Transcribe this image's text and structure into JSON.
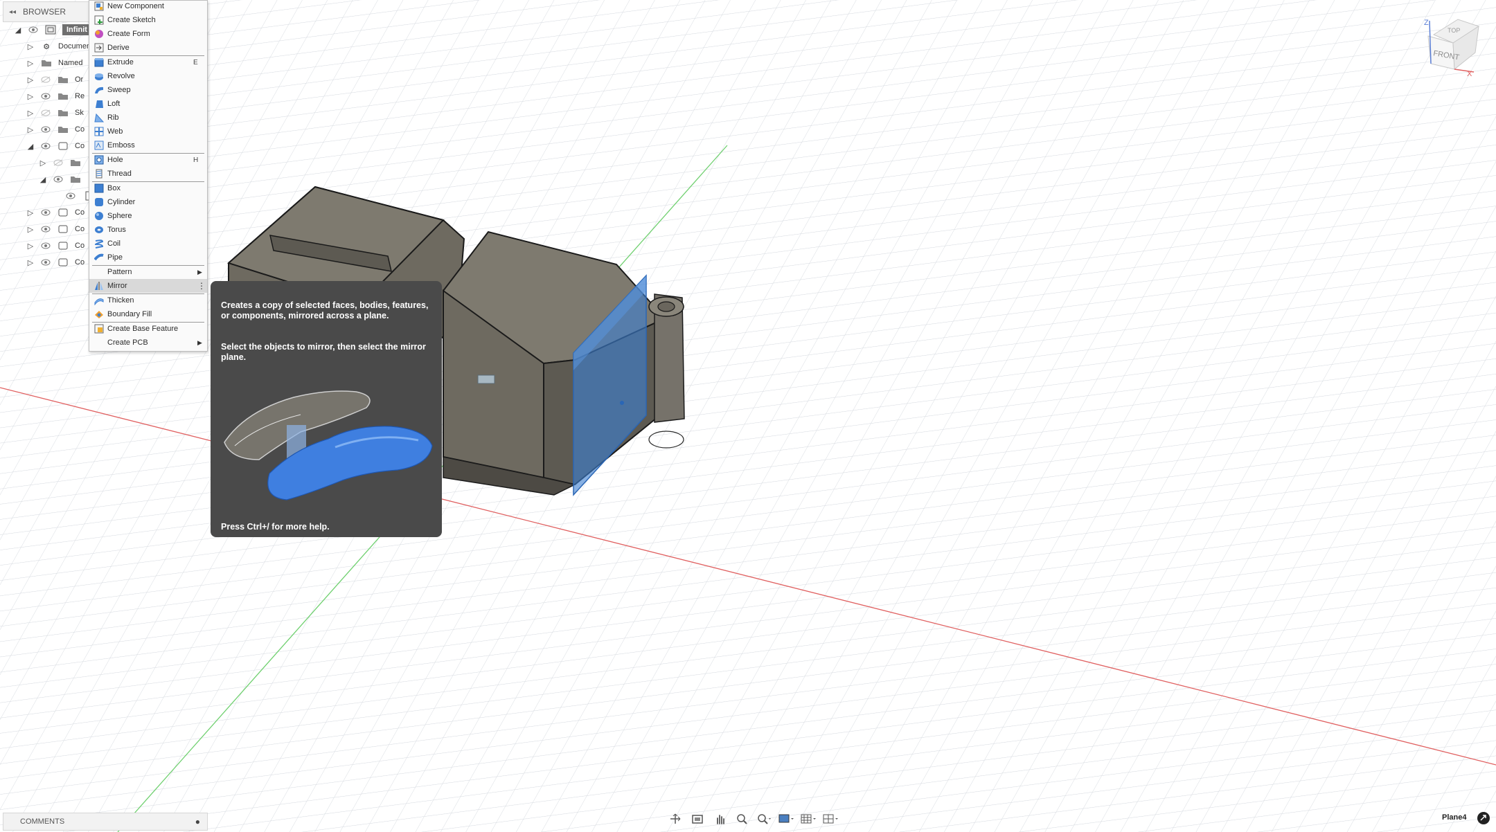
{
  "browser": {
    "title": "BROWSER",
    "rows": [
      {
        "label": "Infinit"
      },
      {
        "label": "Documen"
      },
      {
        "label": "Named"
      },
      {
        "label": "Or"
      },
      {
        "label": "Re"
      },
      {
        "label": "Sk"
      },
      {
        "label": "Co"
      },
      {
        "label": "Co"
      },
      {
        "label": ""
      },
      {
        "label": ""
      },
      {
        "label": ""
      },
      {
        "label": "Co"
      },
      {
        "label": "Co"
      },
      {
        "label": "Co"
      },
      {
        "label": "Co"
      }
    ]
  },
  "menu": {
    "items": [
      {
        "label": "New Component",
        "icon": "new-component-icon"
      },
      {
        "label": "Create Sketch",
        "icon": "create-sketch-icon"
      },
      {
        "label": "Create Form",
        "icon": "create-form-icon"
      },
      {
        "label": "Derive",
        "icon": "derive-icon"
      },
      {
        "label": "Extrude",
        "shortcut": "E",
        "icon": "extrude-icon"
      },
      {
        "label": "Revolve",
        "icon": "revolve-icon"
      },
      {
        "label": "Sweep",
        "icon": "sweep-icon"
      },
      {
        "label": "Loft",
        "icon": "loft-icon"
      },
      {
        "label": "Rib",
        "icon": "rib-icon"
      },
      {
        "label": "Web",
        "icon": "web-icon"
      },
      {
        "label": "Emboss",
        "icon": "emboss-icon"
      },
      {
        "label": "Hole",
        "shortcut": "H",
        "icon": "hole-icon"
      },
      {
        "label": "Thread",
        "icon": "thread-icon"
      },
      {
        "label": "Box",
        "icon": "box-icon"
      },
      {
        "label": "Cylinder",
        "icon": "cylinder-icon"
      },
      {
        "label": "Sphere",
        "icon": "sphere-icon"
      },
      {
        "label": "Torus",
        "icon": "torus-icon"
      },
      {
        "label": "Coil",
        "icon": "coil-icon"
      },
      {
        "label": "Pipe",
        "icon": "pipe-icon"
      },
      {
        "label": "Pattern",
        "submenu": true
      },
      {
        "label": "Mirror",
        "icon": "mirror-icon",
        "highlighted": true
      },
      {
        "label": "Thicken",
        "icon": "thicken-icon"
      },
      {
        "label": "Boundary Fill",
        "icon": "boundary-fill-icon"
      },
      {
        "label": "Create Base Feature",
        "icon": "base-feature-icon"
      },
      {
        "label": "Create PCB",
        "submenu": true
      }
    ]
  },
  "tooltip": {
    "description": "Creates a copy of selected faces, bodies, features, or components, mirrored across a plane.",
    "instruction": "Select the objects to mirror, then select the mirror plane.",
    "help": "Press Ctrl+/ for more help."
  },
  "viewcube": {
    "top": "TOP",
    "front": "FRONT",
    "axis_z": "Z",
    "axis_x": "X"
  },
  "footer": {
    "comments": "COMMENTS",
    "status": "Plane4"
  },
  "colors": {
    "accent": "#3d7fd1",
    "body": "#7a766b",
    "tooltip_bg": "#4a4a4a"
  }
}
